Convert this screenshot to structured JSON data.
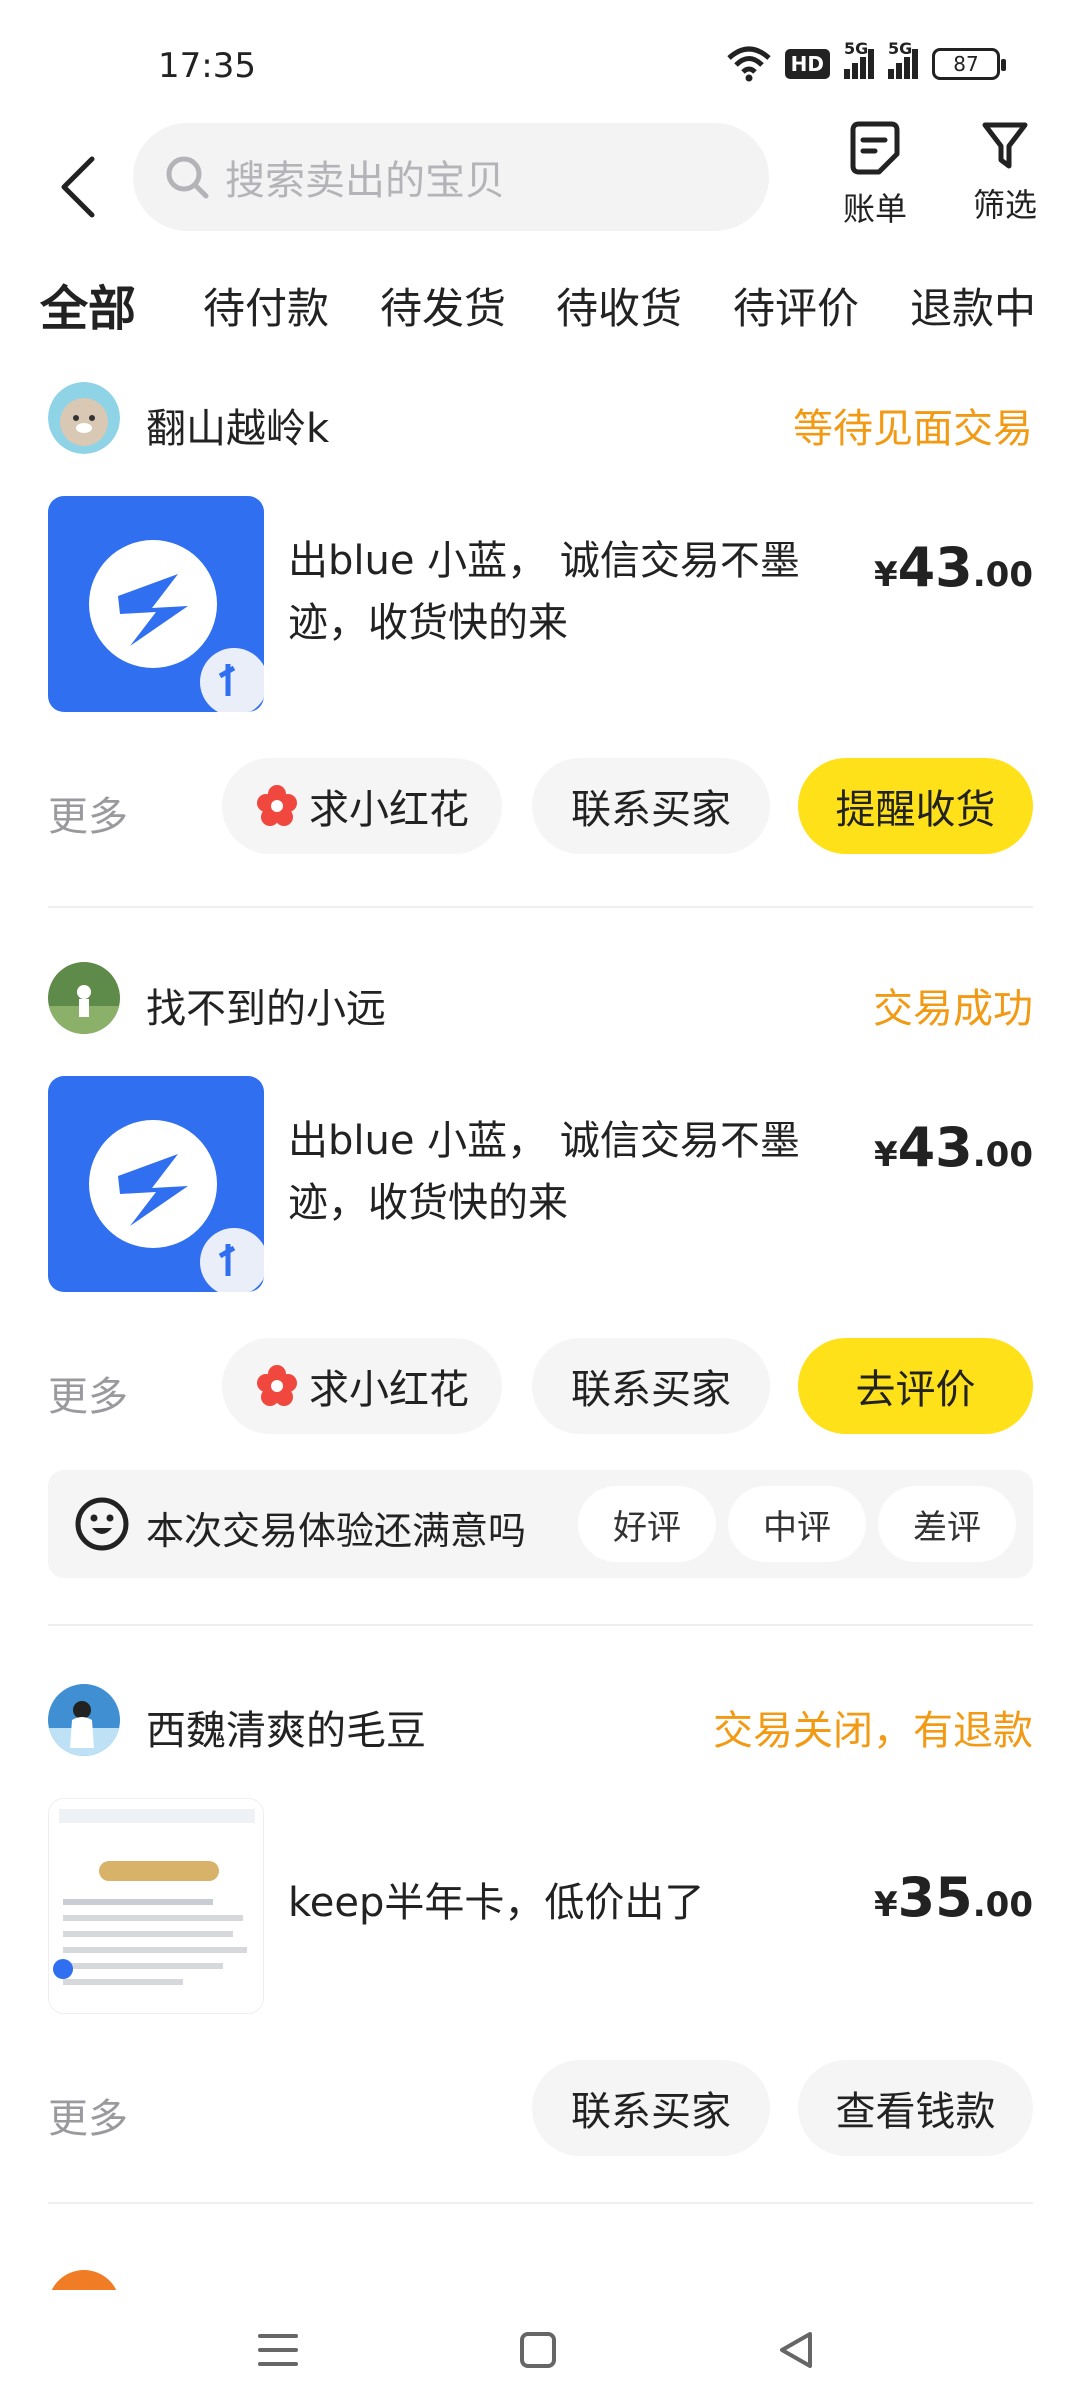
{
  "status_bar": {
    "time": "17:35",
    "hd_label": "HD",
    "network_1": "5G",
    "network_2": "5G",
    "battery": "87"
  },
  "header": {
    "search_placeholder": "搜索卖出的宝贝",
    "bill_label": "账单",
    "filter_label": "筛选"
  },
  "tabs": [
    {
      "label": "全部",
      "active": true
    },
    {
      "label": "待付款",
      "active": false
    },
    {
      "label": "待发货",
      "active": false
    },
    {
      "label": "待收货",
      "active": false
    },
    {
      "label": "待评价",
      "active": false
    },
    {
      "label": "退款中",
      "active": false
    }
  ],
  "orders": [
    {
      "buyer": "翻山越岭k",
      "status": "等待见面交易",
      "title": "出blue 小蓝， 诚信交易不墨迹，收货快的来",
      "price_currency": "¥",
      "price_int": "43",
      "price_dec": ".00",
      "more": "更多",
      "btn_flower": "求小红花",
      "btn_contact": "联系买家",
      "btn_primary": "提醒收货"
    },
    {
      "buyer": "找不到的小远",
      "status": "交易成功",
      "title": "出blue 小蓝， 诚信交易不墨迹，收货快的来",
      "price_currency": "¥",
      "price_int": "43",
      "price_dec": ".00",
      "more": "更多",
      "btn_flower": "求小红花",
      "btn_contact": "联系买家",
      "btn_primary": "去评价",
      "rating": {
        "question": "本次交易体验还满意吗",
        "good": "好评",
        "mid": "中评",
        "bad": "差评"
      }
    },
    {
      "buyer": "西魏清爽的毛豆",
      "status": "交易关闭，有退款",
      "title": "keep半年卡，低价出了",
      "price_currency": "¥",
      "price_int": "35",
      "price_dec": ".00",
      "more": "更多",
      "btn_contact": "联系买家",
      "btn_secondary": "查看钱款"
    }
  ],
  "colors": {
    "accent_yellow": "#ffe11a",
    "status_orange": "#f29a14",
    "app_blue": "#2f6ff0"
  },
  "icons": [
    "back-icon",
    "search-icon",
    "bill-icon",
    "filter-icon",
    "flower-icon",
    "smile-face-icon",
    "menu-icon",
    "home-icon",
    "back-triangle-icon"
  ]
}
